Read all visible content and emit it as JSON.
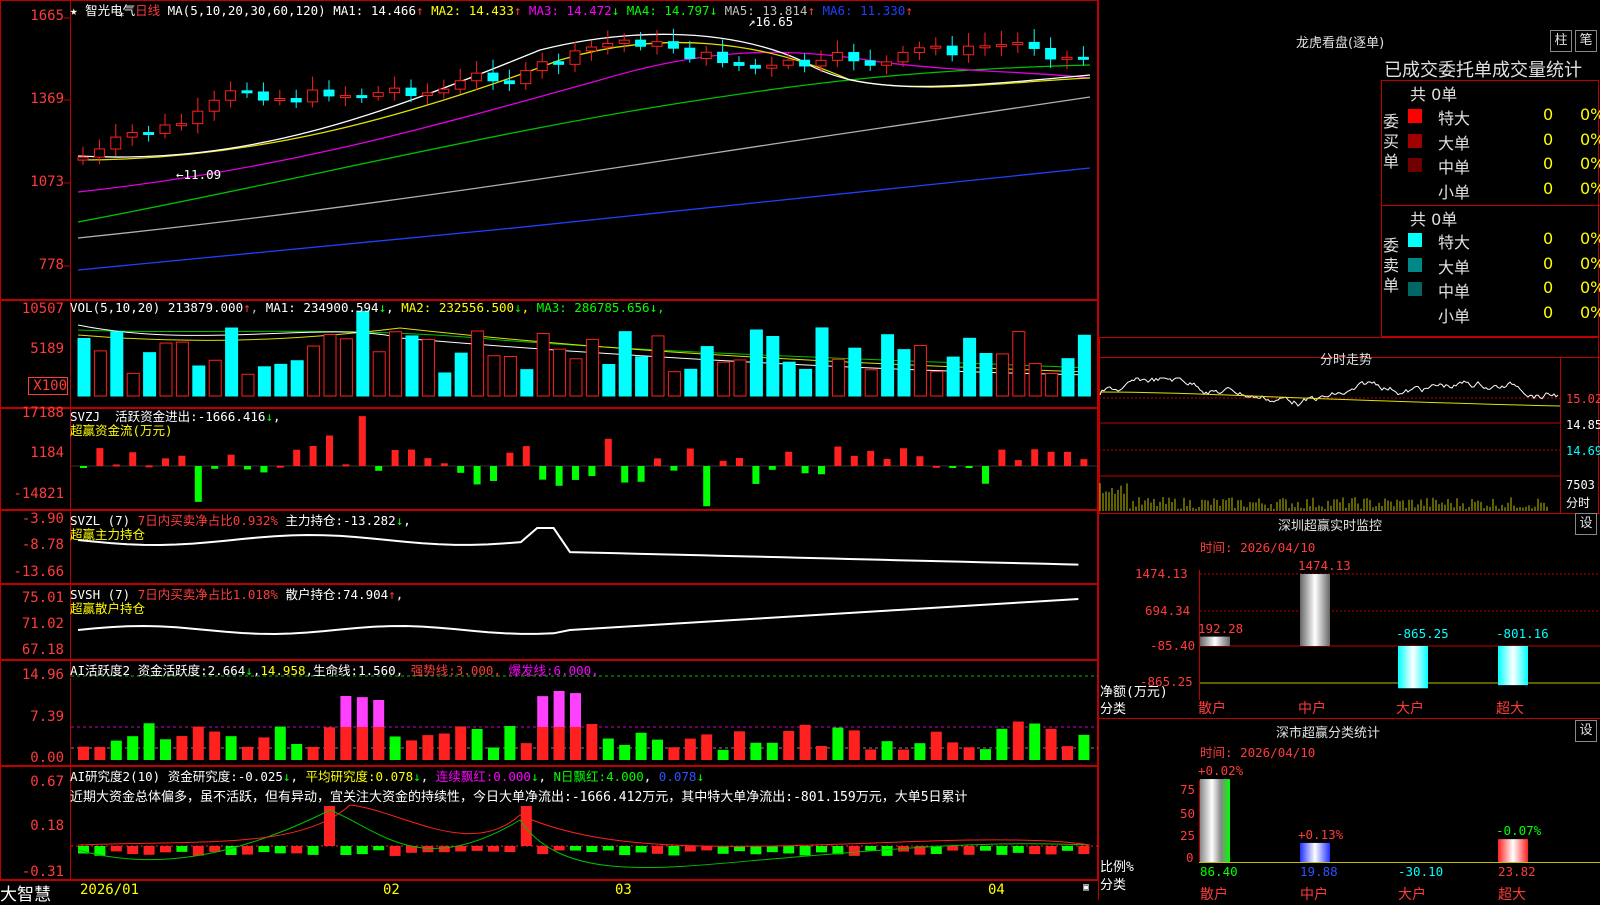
{
  "stock": {
    "name": "智光电气",
    "period": "日线",
    "ma_header": "MA(5,10,20,30,60,120)",
    "ma": [
      {
        "label": "MA1:",
        "value": "14.466",
        "arrow": "↑",
        "color": "#ffffff"
      },
      {
        "label": "MA2:",
        "value": "14.433",
        "arrow": "↑",
        "color": "#ffff00"
      },
      {
        "label": "MA3:",
        "value": "14.472",
        "arrow": "↓",
        "color": "#ff00ff"
      },
      {
        "label": "MA4:",
        "value": "14.797",
        "arrow": "↓",
        "color": "#00ff00"
      },
      {
        "label": "MA5:",
        "value": "13.814",
        "arrow": "↑",
        "color": "#c0c0c0"
      },
      {
        "label": "MA6:",
        "value": "11.330",
        "arrow": "↑",
        "color": "#2040ff"
      }
    ],
    "price_axis": [
      "1665",
      "1369",
      "1073",
      "778"
    ],
    "high_marker": "16.65",
    "low_marker": "11.09"
  },
  "volume": {
    "header": "VOL(5,10,20)",
    "value": "213879.000",
    "ma": [
      {
        "label": "MA1:",
        "value": "234900.594",
        "arrow": "↓",
        "color": "#ffffff"
      },
      {
        "label": "MA2:",
        "value": "232556.500",
        "arrow": "↓",
        "color": "#ffff00"
      },
      {
        "label": "MA3:",
        "value": "286785.656",
        "arrow": "↓",
        "color": "#00ff00"
      }
    ],
    "axis": [
      "10507",
      "5189",
      "X100"
    ]
  },
  "svzj": {
    "header": "SVZJ",
    "label": "活跃资金进出:",
    "value": "-1666.416",
    "subtitle": "超赢资金流(万元)",
    "axis": [
      "17188",
      "1184",
      "-14821"
    ]
  },
  "svzl": {
    "header": "SVZL (7)",
    "ratio_label": "7日内买卖净占比0.932%",
    "label": "主力持仓:",
    "value": "-13.282",
    "subtitle": "超赢主力持仓",
    "axis": [
      "-3.90",
      "-8.78",
      "-13.66"
    ]
  },
  "svsh": {
    "header": "SVSH (7)",
    "ratio_label": "7日内买卖净占比1.018%",
    "label": "散户持仓:",
    "value": "74.904",
    "subtitle": "超赢散户持仓",
    "axis": [
      "75.01",
      "71.02",
      "67.18"
    ]
  },
  "ai_active": {
    "header": "AI活跃度2",
    "label": "资金活跃度:",
    "value": "2.664",
    "extra": "14.958",
    "life_label": "生命线:",
    "life": "1.560",
    "strong_label": "强势线:",
    "strong": "3.000",
    "burst_label": "爆发线:",
    "burst": "6.000",
    "axis": [
      "14.96",
      "7.39",
      "0.00"
    ]
  },
  "ai_research": {
    "header": "AI研究度2(10)",
    "label": "资金研究度:",
    "value": "-0.025",
    "avg_label": "平均研究度:",
    "avg": "0.078",
    "red_label": "连续飘红:",
    "red": "0.000",
    "n_label": "N日飘红:",
    "n": "4.000",
    "last": "0.078",
    "comment": "近期大资金总体偏多，虽不活跃，但有异动，宜关注大资金的持续性，今日大单净流出:-1666.412万元，其中特大单净流出:-801.159万元，大单5日累计",
    "axis": [
      "0.67",
      "0.18",
      "-0.31"
    ]
  },
  "dates": [
    "2026/01",
    "02",
    "03",
    "04"
  ],
  "footer_logo": "大智慧",
  "right": {
    "lhb_title": "龙虎看盘(逐单)",
    "btn1": "柱",
    "btn2": "笔",
    "tabs": "已成交委托单成交量统计",
    "buy": {
      "side": "委买单",
      "total": "共 0单",
      "rows": [
        {
          "name": "特大",
          "count": "0",
          "pct": "0%",
          "color": "#ff0000"
        },
        {
          "name": "大单",
          "count": "0",
          "pct": "0%",
          "color": "#a00000"
        },
        {
          "name": "中单",
          "count": "0",
          "pct": "0%",
          "color": "#700000"
        },
        {
          "name": "小单",
          "count": "0",
          "pct": "0%",
          "color": "#000000"
        }
      ]
    },
    "sell": {
      "side": "委卖单",
      "total": "共 0单",
      "rows": [
        {
          "name": "特大",
          "count": "0",
          "pct": "0%",
          "color": "#00ffff"
        },
        {
          "name": "大单",
          "count": "0",
          "pct": "0%",
          "color": "#008888"
        },
        {
          "name": "中单",
          "count": "0",
          "pct": "0%",
          "color": "#006666"
        },
        {
          "name": "小单",
          "count": "0",
          "pct": "0%",
          "color": "#000000"
        }
      ]
    },
    "intraday": {
      "title": "分时走势",
      "price_labels": [
        "15.02",
        "14.85",
        "14.69"
      ],
      "vol_label": "7503",
      "vol_unit": "分时"
    },
    "monitor": {
      "title": "深圳超赢实时监控",
      "btn": "设",
      "time_label": "时间:",
      "time": "2026/04/10",
      "axis": [
        "1474.13",
        "694.34",
        "-85.40",
        "-865.25"
      ],
      "ylabel": "净额(万元)",
      "xlabel": "分类",
      "bars": [
        {
          "cat": "散户",
          "value": 192.28,
          "label": "192.28"
        },
        {
          "cat": "中户",
          "value": 1474.13,
          "label": "1474.13"
        },
        {
          "cat": "大户",
          "value": -865.25,
          "label": "-865.25"
        },
        {
          "cat": "超大",
          "value": -801.16,
          "label": "-801.16"
        }
      ]
    },
    "classify": {
      "title": "深市超赢分类统计",
      "btn": "设",
      "time_label": "时间:",
      "time": "2026/04/10",
      "axis": [
        "75",
        "50",
        "25",
        "0"
      ],
      "ylabel": "比例%",
      "xlabel": "分类",
      "bars": [
        {
          "cat": "散户",
          "value": 86.4,
          "label": "86.40",
          "change": "+0.02%"
        },
        {
          "cat": "中户",
          "value": 19.88,
          "label": "19.88",
          "change": "+0.13%"
        },
        {
          "cat": "大户",
          "value": -30.1,
          "label": "-30.10",
          "change": ""
        },
        {
          "cat": "超大",
          "value": 23.82,
          "label": "23.82",
          "change": "-0.07%"
        }
      ]
    }
  }
}
